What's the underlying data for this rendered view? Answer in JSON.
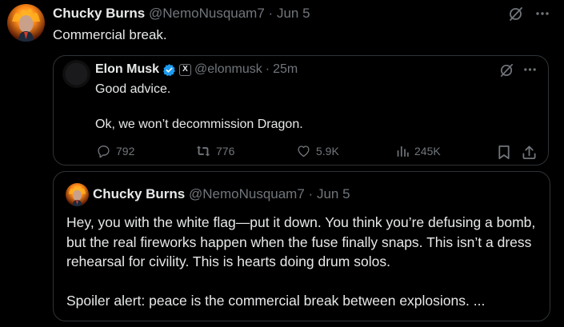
{
  "outer_tweet": {
    "author_name": "Chucky Burns",
    "handle": "@NemoNusquam7",
    "separator": "·",
    "date": "Jun 5",
    "text": "Commercial break.",
    "icons": [
      "grok-icon",
      "more-icon"
    ]
  },
  "quoted_tweet_1": {
    "author_name": "Elon Musk",
    "verified": true,
    "affiliate_badge": "X",
    "handle": "@elonmusk",
    "separator": "·",
    "time": "25m",
    "lines": [
      "Good advice.",
      "Ok, we won’t decommission Dragon."
    ],
    "metrics": {
      "replies": "792",
      "reposts": "776",
      "likes": "5.9K",
      "views": "245K"
    },
    "colors": {
      "verified": "#1d9bf0"
    }
  },
  "quoted_tweet_2": {
    "author_name": "Chucky Burns",
    "handle": "@NemoNusquam7",
    "separator": "·",
    "date": "Jun 5",
    "paragraph_1": "Hey, you with the white flag—put it down. You think you’re defusing a bomb, but the real fireworks happen when the fuse finally snaps. This isn’t a dress rehearsal for civility. This is hearts doing drum solos.",
    "paragraph_2": "Spoiler alert: peace is the commercial break between explosions. ..."
  },
  "theme": {
    "background": "#000000",
    "text_primary": "#e7e9ea",
    "text_secondary": "#71767b",
    "border": "#2f3336"
  }
}
